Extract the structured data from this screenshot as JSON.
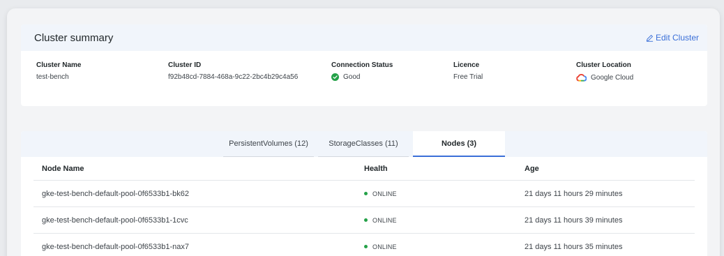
{
  "summary": {
    "title": "Cluster summary",
    "edit_label": "Edit Cluster",
    "fields": {
      "cluster_name": {
        "label": "Cluster Name",
        "value": "test-bench"
      },
      "cluster_id": {
        "label": "Cluster ID",
        "value": "f92b48cd-7884-468a-9c22-2bc4b29c4a56"
      },
      "connection_status": {
        "label": "Connection Status",
        "value": "Good",
        "icon": "check-circle-icon",
        "color": "#24a148"
      },
      "licence": {
        "label": "Licence",
        "value": "Free Trial"
      },
      "cluster_location": {
        "label": "Cluster Location",
        "value": "Google Cloud",
        "icon": "google-cloud-icon"
      }
    }
  },
  "tabs": [
    {
      "label": "PersistentVolumes (12)",
      "active": false
    },
    {
      "label": "StorageClasses (11)",
      "active": false
    },
    {
      "label": "Nodes (3)",
      "active": true
    }
  ],
  "table": {
    "headers": {
      "name": "Node Name",
      "health": "Health",
      "age": "Age"
    },
    "rows": [
      {
        "name": "gke-test-bench-default-pool-0f6533b1-bk62",
        "health": "ONLINE",
        "age": "21 days 11 hours 29 minutes"
      },
      {
        "name": "gke-test-bench-default-pool-0f6533b1-1cvc",
        "health": "ONLINE",
        "age": "21 days 11 hours 39 minutes"
      },
      {
        "name": "gke-test-bench-default-pool-0f6533b1-nax7",
        "health": "ONLINE",
        "age": "21 days 11 hours 35 minutes"
      }
    ]
  },
  "colors": {
    "accent": "#3a6fd8",
    "status_online": "#24a148",
    "header_bg": "#f1f5fb"
  }
}
